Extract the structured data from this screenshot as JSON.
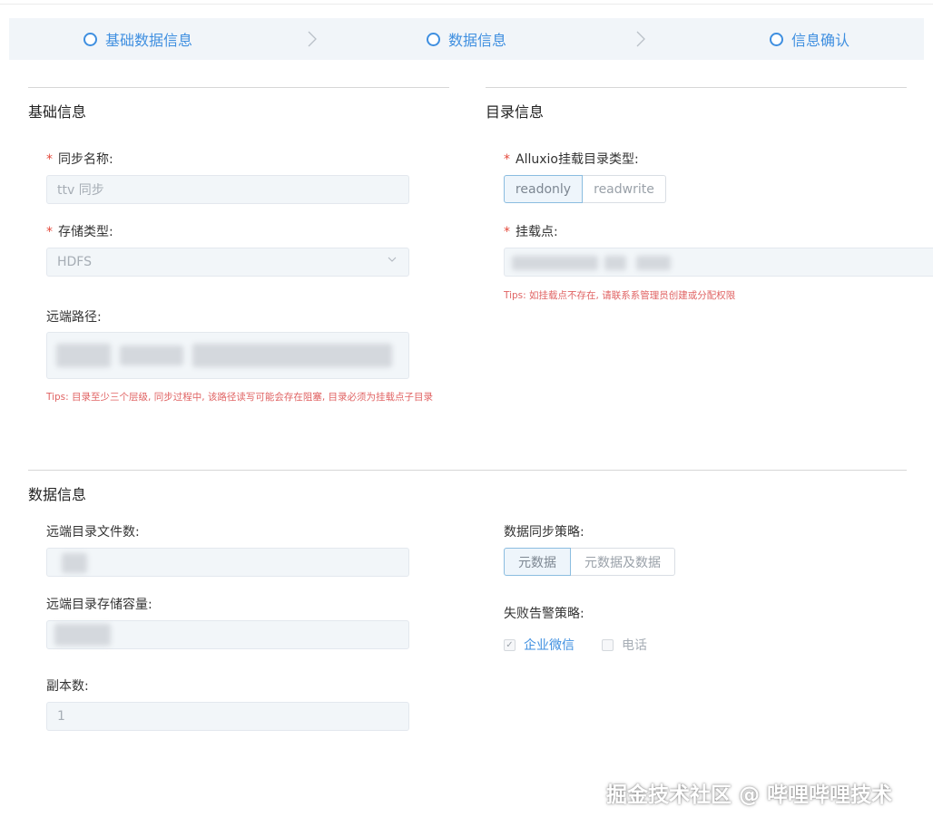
{
  "steps": [
    {
      "label": "基础数据信息"
    },
    {
      "label": "数据信息"
    },
    {
      "label": "信息确认"
    }
  ],
  "basic": {
    "title": "基础信息",
    "sync_name": {
      "label": "同步名称:",
      "value": "ttv 同步"
    },
    "storage_type": {
      "label": "存储类型:",
      "value": "HDFS"
    },
    "remote_path": {
      "label": "远端路径:"
    },
    "tips": "Tips: 目录至少三个层级, 同步过程中, 该路径读写可能会存在阻塞, 目录必须为挂载点子目录"
  },
  "directory": {
    "title": "目录信息",
    "mount_type": {
      "label": "Alluxio挂载目录类型:",
      "options": [
        "readonly",
        "readwrite"
      ],
      "selected": "readonly"
    },
    "mount_point": {
      "label": "挂载点:"
    },
    "tips": "Tips: 如挂载点不存在, 请联系系管理员创建或分配权限"
  },
  "data": {
    "title": "数据信息",
    "file_count": {
      "label": "远端目录文件数:"
    },
    "capacity": {
      "label": "远端目录存储容量:"
    },
    "replicas": {
      "label": "副本数:",
      "value": "1"
    },
    "strategy": {
      "label": "数据同步策略:",
      "options": [
        "元数据",
        "元数据及数据"
      ],
      "selected": "元数据"
    },
    "alert": {
      "label": "失败告警策略:",
      "options": [
        {
          "label": "企业微信",
          "checked": true
        },
        {
          "label": "电话",
          "checked": false
        }
      ]
    }
  },
  "watermark": "掘金技术社区 @ 哔哩哔哩技术",
  "colors": {
    "accent": "#3f8fe0",
    "tips": "#e06363",
    "required": "#e4493b"
  }
}
